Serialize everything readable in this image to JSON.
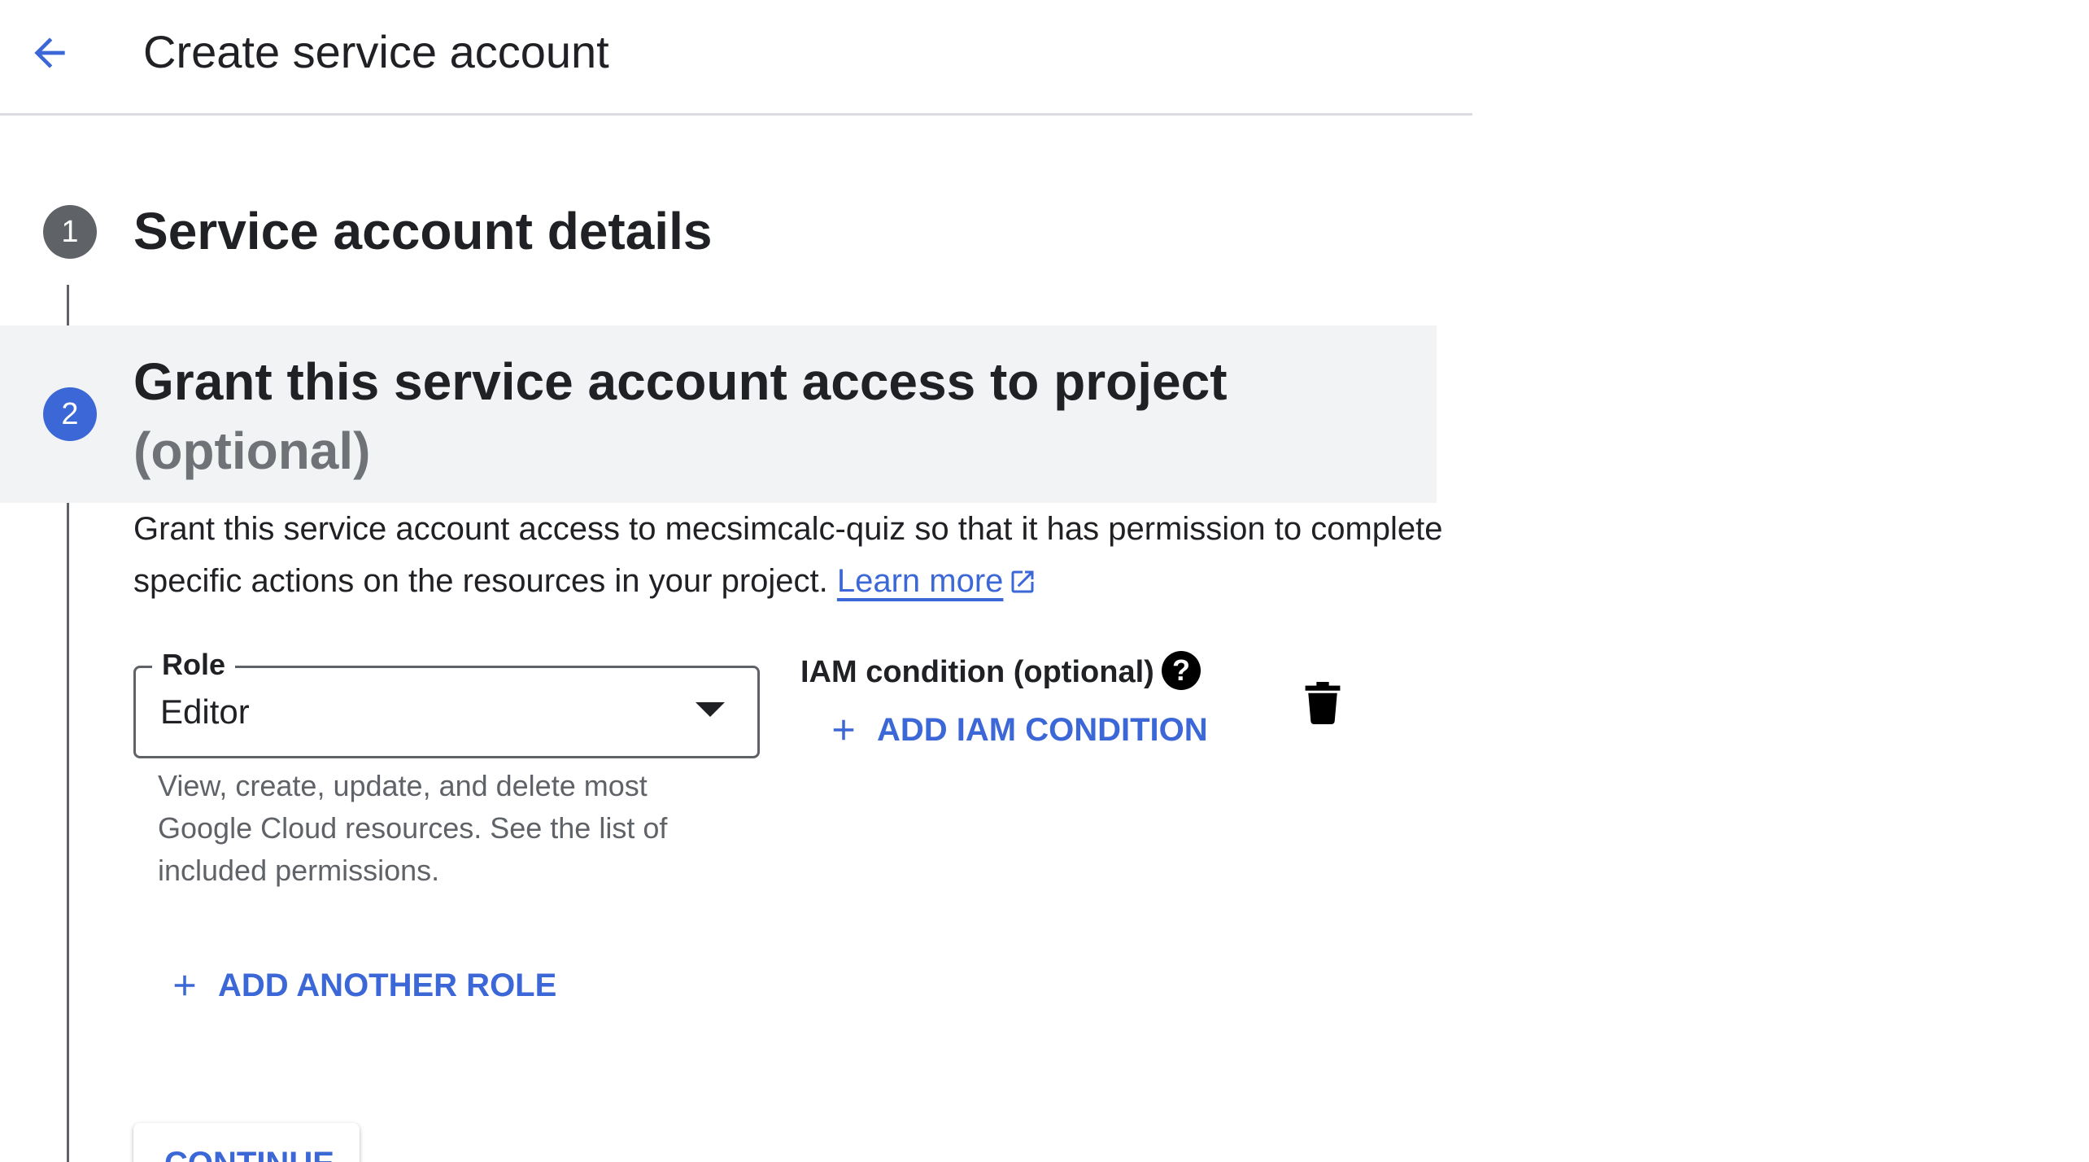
{
  "header": {
    "back_icon": "arrow-left-icon",
    "title": "Create service account"
  },
  "steps": [
    {
      "number": "1",
      "title": "Service account details",
      "state": "done"
    },
    {
      "number": "2",
      "title": "Grant this service account access to project",
      "title_suffix": "(optional)",
      "state": "active"
    }
  ],
  "grant": {
    "description": "Grant this service account access to mecsimcalc-quiz so that it has permission to complete specific actions on the resources in your project.",
    "learn_more": "Learn more",
    "learn_more_icon": "external-link-icon"
  },
  "role": {
    "label": "Role",
    "value": "Editor",
    "help_text": "View, create, update, and delete most Google Cloud resources. See the list of included permissions."
  },
  "iam_condition": {
    "label": "IAM condition (optional)",
    "help_icon": "help-circle-icon",
    "add_label": "ADD IAM CONDITION"
  },
  "delete_icon": "trash-icon",
  "add_another_role": "ADD ANOTHER ROLE",
  "continue_label": "CONTINUE",
  "colors": {
    "accent": "#3c67d6",
    "step_done": "#5f6368",
    "active_band": "#f1f3f4",
    "text": "#202124",
    "muted": "#5f6368"
  }
}
